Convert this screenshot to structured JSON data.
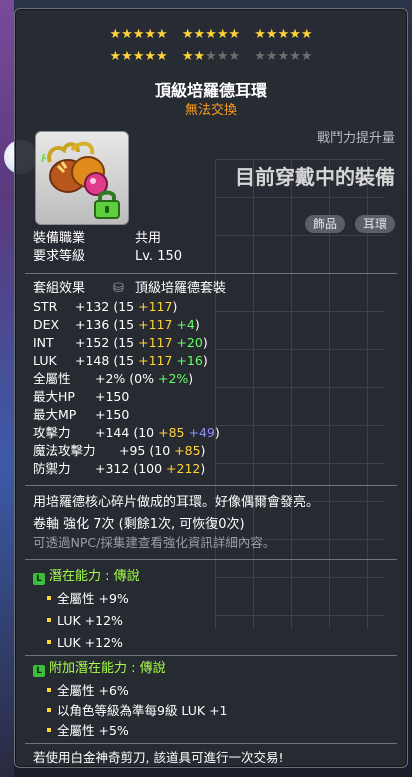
{
  "stars": {
    "row1": [
      5,
      5,
      5
    ],
    "row2": [
      5,
      5,
      5
    ],
    "row2_filled": 7
  },
  "item": {
    "name": "頂級培羅德耳環",
    "trade": "無法交換",
    "icon": "earring-icon",
    "lock_icon": "lock-icon"
  },
  "right_panel": {
    "power": "戰鬥力提升量",
    "equipped": "目前穿戴中的裝備",
    "tags": [
      "飾品",
      "耳環"
    ]
  },
  "requirements": [
    {
      "label": "裝備職業",
      "value": "共用"
    },
    {
      "label": "要求等級",
      "value": "Lv. 150"
    }
  ],
  "set": {
    "label": "套組效果",
    "value": "頂級培羅德套裝"
  },
  "stats": [
    {
      "name": "STR",
      "total": "+132",
      "base": "(15",
      "star": "+117",
      "extra": "",
      "extra_color": "",
      "close": ")"
    },
    {
      "name": "DEX",
      "total": "+136",
      "base": "(15",
      "star": "+117",
      "extra": "+4",
      "extra_color": "green",
      "close": ")"
    },
    {
      "name": "INT",
      "total": "+152",
      "base": "(15",
      "star": "+117",
      "extra": "+20",
      "extra_color": "green",
      "close": ")"
    },
    {
      "name": "LUK",
      "total": "+148",
      "base": "(15",
      "star": "+117",
      "extra": "+16",
      "extra_color": "green",
      "close": ")"
    }
  ],
  "stats2": [
    {
      "name": "全屬性",
      "total": "+2%",
      "base": "(0%",
      "star": "",
      "extra": "+2%",
      "extra_color": "green",
      "close": ")"
    },
    {
      "name": "最大HP",
      "total": "+150",
      "base": "",
      "star": "",
      "extra": "",
      "extra_color": "",
      "close": ""
    },
    {
      "name": "最大MP",
      "total": "+150",
      "base": "",
      "star": "",
      "extra": "",
      "extra_color": "",
      "close": ""
    },
    {
      "name": "攻擊力",
      "total": "+144",
      "base": "(10",
      "star": "+85",
      "extra": "+49",
      "extra_color": "blue",
      "close": ")"
    },
    {
      "name": "魔法攻擊力",
      "total": "+95",
      "base": "(10",
      "star": "+85",
      "extra": "",
      "extra_color": "",
      "close": ")"
    },
    {
      "name": "防禦力",
      "total": "+312",
      "base": "(100",
      "star": "+212",
      "extra": "",
      "extra_color": "",
      "close": ")"
    }
  ],
  "description": "用培羅德核心碎片做成的耳環。好像偶爾會發亮。",
  "upgrade": {
    "text": "卷軸 強化 7次 (剩餘1次, 可恢復0次)",
    "hint": "可透過NPC/採集建查看強化資訊詳細內容。"
  },
  "potential": {
    "title": "潛在能力 : 傳說",
    "lines": [
      "全屬性 +9%",
      "LUK +12%",
      "LUK +12%"
    ]
  },
  "bonus_potential": {
    "title": "附加潛在能力 : 傳說",
    "lines": [
      "全屬性 +6%",
      "以角色等級為準每9級 LUK +1",
      "全屬性 +5%"
    ]
  },
  "footer": "若使用白金神奇剪刀, 該道具可進行一次交易!"
}
